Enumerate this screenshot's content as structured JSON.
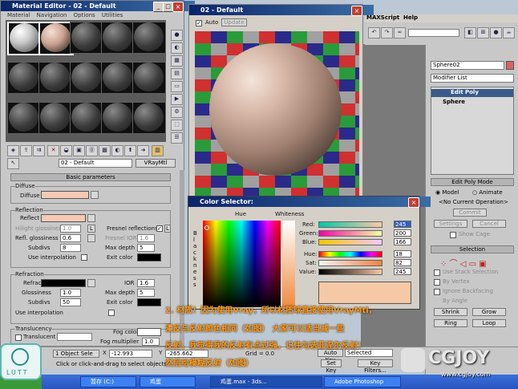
{
  "material_editor": {
    "title": "Material Editor - 02 - Default",
    "menu": [
      "Material",
      "Navigation",
      "Options",
      "Utilities"
    ],
    "material_name": "02 - Default",
    "material_type": "VRayMtl",
    "rollout_title": "Basic parameters",
    "diffuse": {
      "group": "Diffuse",
      "label": "Diffuse",
      "color": "#f5c9b4"
    },
    "reflection": {
      "group": "Reflection",
      "reflect_label": "Reflect",
      "reflect_color": "#f5c9b4",
      "hilight_label": "Hilight glossiness",
      "hilight_value": "1.0",
      "fresnel_label": "Fresnel reflections",
      "refl_gloss_label": "Refl. glossiness",
      "refl_gloss_value": "0.6",
      "fresnel_ior_label": "Fresnel IOR",
      "fresnel_ior_value": "1.6",
      "subdivs_label": "Subdivs",
      "subdivs_value": "8",
      "max_depth_label": "Max depth",
      "max_depth_value": "5",
      "interp_label": "Use interpolation",
      "exit_label": "Exit color"
    },
    "refraction": {
      "group": "Refraction",
      "refract_label": "Refract",
      "ior_label": "IOR",
      "ior_value": "1.6",
      "gloss_label": "Glossiness",
      "gloss_value": "1.0",
      "max_depth_label": "Max depth",
      "max_depth_value": "5",
      "subdivs_label": "Subdivs",
      "subdivs_value": "50",
      "exit_label": "Exit color",
      "interp_label": "Use interpolation"
    },
    "translucency": {
      "group": "Translucency",
      "translucent_label": "Translucent",
      "fog_color_label": "Fog color",
      "fog_mult_label": "Fog multiplier",
      "fog_mult_value": "1.0"
    },
    "lock_letter": "L"
  },
  "preview": {
    "title": "02 - Default",
    "auto_label": "Auto",
    "update_label": "Update"
  },
  "color_selector": {
    "title": "Color Selector:",
    "hue_label": "Hue",
    "whiteness_label": "Whiteness",
    "blackness_label": "B l a c k n e s s",
    "red_label": "Red:",
    "red": "245",
    "green_label": "Green:",
    "green": "200",
    "blue_label": "Blue:",
    "blue": "166",
    "hue_field_label": "Hue:",
    "hue": "18",
    "sat_label": "Sat:",
    "sat": "82",
    "value_label": "Value:",
    "value": "245",
    "current_color": "#f5c8a6"
  },
  "max_ui": {
    "menu": [
      "MAXScript",
      "Help"
    ],
    "object_name": "Sphere02",
    "modifier_list": "Modifier List",
    "stack": [
      "Edit Poly",
      "Sphere"
    ],
    "edit_poly_mode": "Edit Poly Mode",
    "model_label": "Model",
    "animate_label": "Animate",
    "no_op": "<No Current Operation>",
    "commit": "Commit",
    "settings": "Settings",
    "cancel": "Cancel",
    "show_cage": "Show Cage",
    "selection": "Selection",
    "use_stack": "Use Stack Selection",
    "by_vertex": "By Vertex",
    "ignore_backfacing": "Ignore Backfacing",
    "by_angle": "By Angle",
    "shrink": "Shrink",
    "grow": "Grow",
    "ring": "Ring",
    "loop": "Loop"
  },
  "status": {
    "objects": "1 Object Sele",
    "prompt": "Click or click-and-drag to select objects",
    "x_label": "X",
    "x_value": "-12.993",
    "y_label": "Y",
    "y_value": "-265.662",
    "grid": "Grid = 0.0",
    "auto_key": "Auto Key",
    "selected": "Selected",
    "set_key": "Set Key",
    "key_filters": "Key Filters..."
  },
  "taskbar": [
    "暂存 (C:)",
    "鸡蛋",
    "鸡蛋.max - 3ds...",
    "Adobe Photoshop"
  ],
  "overlay": {
    "line1": "2. 材质！因为使用Vray，所以材质球直接使用VrayMtl，",
    "line2": "漫反与反射颜色相同（如图）   大家可以适当减一些",
    "line3": "反射，我觉得我的反射有点过强，记住勾选菲涅尔反射！",
    "line4": "然后给模糊反射（如图）"
  },
  "logos": {
    "lutt": "LUTT",
    "cgjoy_main": "CGJOY",
    "cgjoy_sub": "www.cgjoy.com"
  }
}
